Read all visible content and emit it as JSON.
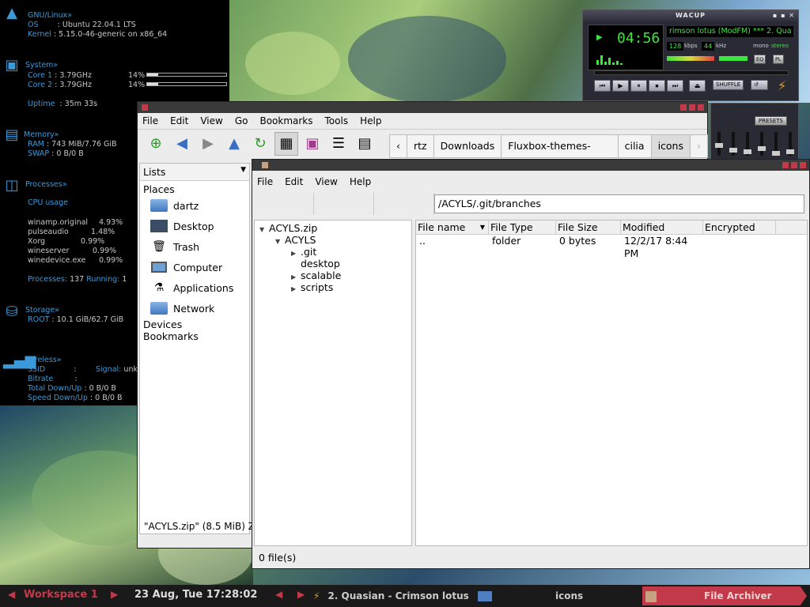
{
  "conky": {
    "os_header": "GNU/Linux»",
    "os_label": "OS",
    "os_value": "Ubuntu 22.04.1 LTS",
    "kernel_label": "Kernel",
    "kernel_value": "5.15.0-46-generic on x86_64",
    "system_header": "System»",
    "core1_label": "Core 1",
    "core1_value": "3.79GHz",
    "core1_pct": "14%",
    "core2_label": "Core 2",
    "core2_value": "3.79GHz",
    "core2_pct": "14%",
    "uptime_label": "Uptime",
    "uptime_value": "35m 33s",
    "memory_header": "Memory»",
    "ram_label": "RAM",
    "ram_value": "743 MiB/7.76 GiB",
    "swap_label": "SWAP",
    "swap_value": "0 B/0 B",
    "processes_header": "Processes»",
    "cpu_usage_label": "CPU usage",
    "processes": [
      {
        "name": "winamp.original",
        "pct": "4.93%"
      },
      {
        "name": "pulseaudio",
        "pct": "1.48%"
      },
      {
        "name": "Xorg",
        "pct": "0.99%"
      },
      {
        "name": "wineserver",
        "pct": "0.99%"
      },
      {
        "name": "winedevice.exe",
        "pct": "0.99%"
      }
    ],
    "processes_count_label": "Processes:",
    "processes_count": "137",
    "running_label": "Running:",
    "running_count": "1",
    "storage_header": "Storage»",
    "root_label": "ROOT",
    "root_value": "10.1 GiB/62.7 GiB",
    "wireless_header": "Wireless»",
    "ssid_label": "SSID",
    "signal_label": "Signal:",
    "signal_value": "unk",
    "bitrate_label": "Bitrate",
    "total_label": "Total Down/Up",
    "total_value": "0 B/0 B",
    "speed_label": "Speed Down/Up",
    "speed_value": "0 B/0 B"
  },
  "winamp": {
    "title": "WACUP",
    "time": "04:56",
    "ticker": "rimson lotus (ModFM) *** 2. Qua",
    "kbps": "128",
    "kbps_label": "kbps",
    "khz": "44",
    "khz_label": "kHz",
    "mono": "mono",
    "stereo": "stereo",
    "eq_btn": "EQ",
    "pl_btn": "PL",
    "shuffle": "SHUFFLE",
    "presets": "PRESETS"
  },
  "file_manager": {
    "menu": [
      "File",
      "Edit",
      "View",
      "Go",
      "Bookmarks",
      "Tools",
      "Help"
    ],
    "breadcrumbs": [
      "rtz",
      "Downloads",
      "Fluxbox-themes-master",
      "cilia",
      "icons"
    ],
    "side_dropdown": "Lists",
    "places_header": "Places",
    "places": [
      "dartz",
      "Desktop",
      "Trash",
      "Computer",
      "Applications",
      "Network"
    ],
    "devices_header": "Devices",
    "bookmarks_header": "Bookmarks",
    "status": "\"ACYLS.zip\" (8.5 MiB) Z"
  },
  "archiver": {
    "menu": [
      "File",
      "Edit",
      "View",
      "Help"
    ],
    "path": "/ACYLS/.git/branches",
    "tree": [
      {
        "label": "ACYLS.zip",
        "depth": 0,
        "arrow": "down"
      },
      {
        "label": "ACYLS",
        "depth": 1,
        "arrow": "down"
      },
      {
        "label": ".git",
        "depth": 2,
        "arrow": "right"
      },
      {
        "label": "desktop",
        "depth": 2,
        "arrow": "none"
      },
      {
        "label": "scalable",
        "depth": 2,
        "arrow": "right"
      },
      {
        "label": "scripts",
        "depth": 2,
        "arrow": "right"
      }
    ],
    "columns": [
      "File name",
      "File Type",
      "File Size",
      "Modified",
      "Encrypted"
    ],
    "rows": [
      {
        "name": "..",
        "type": "folder",
        "size": "0 bytes",
        "modified": "12/2/17 8:44 PM",
        "encrypted": ""
      }
    ],
    "status": "0 file(s)"
  },
  "taskbar": {
    "workspace": "Workspace 1",
    "clock": "23 Aug, Tue 17:28:02",
    "tasks": [
      {
        "label": "2. Quasian - Crimson lotus ("
      },
      {
        "label": "icons"
      },
      {
        "label": "File Archiver"
      }
    ]
  },
  "colors": {
    "accent": "#c23a4a",
    "conky_blue": "#3a9ad9",
    "winamp_green": "#3ee53e"
  }
}
